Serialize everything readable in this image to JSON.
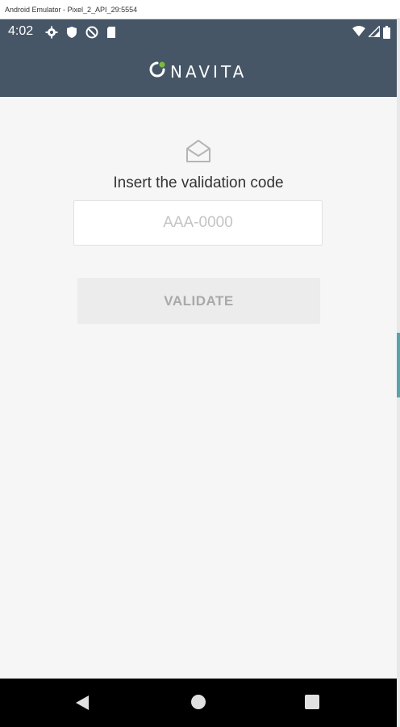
{
  "window": {
    "title": "Android Emulator - Pixel_2_API_29:5554"
  },
  "status_bar": {
    "time": "4:02",
    "left_icons": [
      "gear-icon",
      "shield-icon",
      "no-data-icon",
      "sd-card-icon"
    ],
    "right_icons": [
      "wifi-icon",
      "signal-icon",
      "battery-icon"
    ],
    "background": "#465667"
  },
  "app_bar": {
    "logo_text": "NAVITA",
    "background": "#465667",
    "logo_accent": "#7dbb3c"
  },
  "validation": {
    "icon": "envelope-open-icon",
    "instruction": "Insert the validation code",
    "input": {
      "value": "",
      "placeholder": "AAA-0000"
    },
    "button_label": "VALIDATE"
  },
  "nav_bar": {
    "icons": [
      "back-icon",
      "home-icon",
      "recents-icon"
    ]
  }
}
